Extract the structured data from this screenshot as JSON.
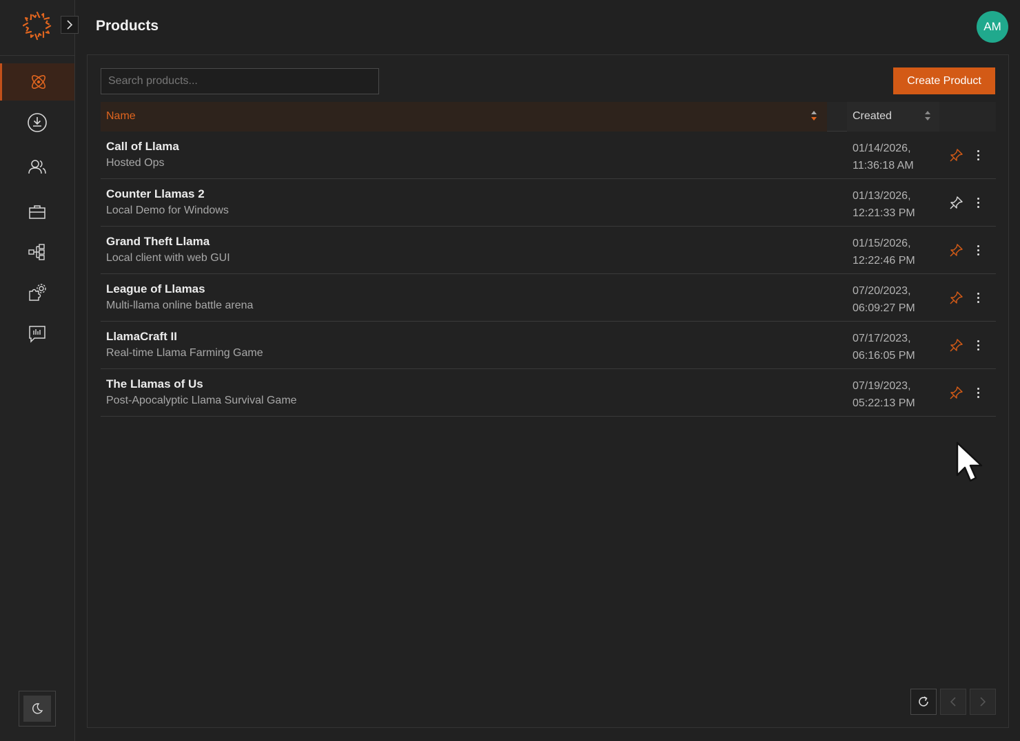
{
  "app": {
    "page_title": "Products",
    "avatar_initials": "AM",
    "accent_color": "#d35a16",
    "avatar_color": "#20a98d"
  },
  "sidebar": {
    "items": [
      {
        "icon": "atom-icon",
        "active": true
      },
      {
        "icon": "download-icon",
        "active": false
      },
      {
        "icon": "users-icon",
        "active": false
      },
      {
        "icon": "briefcase-icon",
        "active": false
      },
      {
        "icon": "hierarchy-icon",
        "active": false
      },
      {
        "icon": "puzzle-gear-icon",
        "active": false
      },
      {
        "icon": "feedback-icon",
        "active": false
      }
    ],
    "theme_icon": "moon-icon"
  },
  "toolbar": {
    "search_placeholder": "Search products...",
    "create_label": "Create Product"
  },
  "table": {
    "headers": {
      "name": "Name",
      "created": "Created"
    },
    "rows": [
      {
        "name": "Call of Llama",
        "desc": "Hosted Ops",
        "date": "01/14/2026,",
        "time": "11:36:18 AM",
        "pinned": true
      },
      {
        "name": "Counter Llamas 2",
        "desc": "Local Demo for Windows",
        "date": "01/13/2026,",
        "time": "12:21:33 PM",
        "pinned": false
      },
      {
        "name": "Grand Theft Llama",
        "desc": "Local client with web GUI",
        "date": "01/15/2026,",
        "time": "12:22:46 PM",
        "pinned": true
      },
      {
        "name": "League of Llamas",
        "desc": "Multi-llama online battle arena",
        "date": "07/20/2023,",
        "time": "06:09:27 PM",
        "pinned": true
      },
      {
        "name": "LlamaCraft II",
        "desc": "Real-time Llama Farming Game",
        "date": "07/17/2023,",
        "time": "06:16:05 PM",
        "pinned": true
      },
      {
        "name": "The Llamas of Us",
        "desc": "Post-Apocalyptic Llama Survival Game",
        "date": "07/19/2023,",
        "time": "05:22:13 PM",
        "pinned": true
      }
    ]
  },
  "pagination": {
    "refresh_icon": "refresh-icon",
    "prev_icon": "chevron-left-icon",
    "next_icon": "chevron-right-icon"
  }
}
